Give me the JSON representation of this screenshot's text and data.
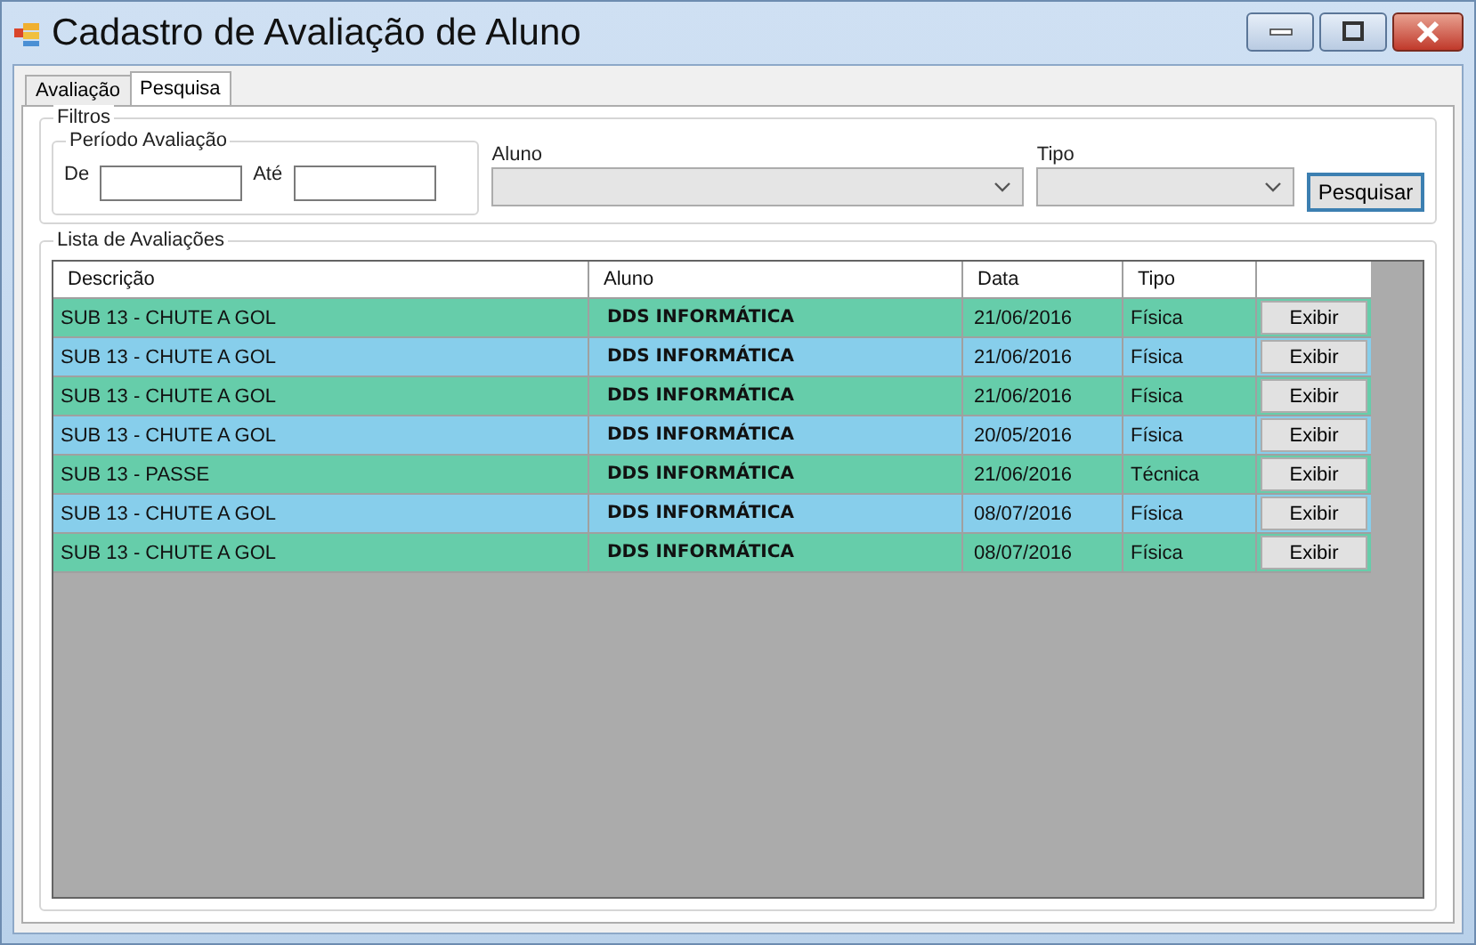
{
  "window": {
    "title": "Cadastro de Avaliação de Aluno"
  },
  "tabs": [
    {
      "label": "Avaliação",
      "selected": false
    },
    {
      "label": "Pesquisa",
      "selected": true
    }
  ],
  "filters": {
    "title": "Filtros",
    "period": {
      "title": "Período Avaliação",
      "from_label": "De",
      "to_label": "Até"
    },
    "student_label": "Aluno",
    "type_label": "Tipo",
    "search_button": "Pesquisar"
  },
  "list": {
    "title": "Lista de Avaliações",
    "columns": [
      "Descrição",
      "Aluno",
      "Data",
      "Tipo"
    ],
    "rows": [
      {
        "description": "SUB 13 - CHUTE A GOL",
        "student": "DDS INFORMÁTICA",
        "date": "21/06/2016",
        "type": "Física",
        "action": "Exibir",
        "color": "#66cdaa"
      },
      {
        "description": "SUB 13 - CHUTE A GOL",
        "student": "DDS INFORMÁTICA",
        "date": "21/06/2016",
        "type": "Física",
        "action": "Exibir",
        "color": "#87ceeb"
      },
      {
        "description": "SUB 13 - CHUTE A GOL",
        "student": "DDS INFORMÁTICA",
        "date": "21/06/2016",
        "type": "Física",
        "action": "Exibir",
        "color": "#66cdaa"
      },
      {
        "description": "SUB 13 - CHUTE A GOL",
        "student": "DDS INFORMÁTICA",
        "date": "20/05/2016",
        "type": "Física",
        "action": "Exibir",
        "color": "#87ceeb"
      },
      {
        "description": "SUB 13 - PASSE",
        "student": "DDS INFORMÁTICA",
        "date": "21/06/2016",
        "type": "Técnica",
        "action": "Exibir",
        "color": "#66cdaa"
      },
      {
        "description": "SUB 13 - CHUTE A GOL",
        "student": "DDS INFORMÁTICA",
        "date": "08/07/2016",
        "type": "Física",
        "action": "Exibir",
        "color": "#87ceeb"
      },
      {
        "description": "SUB 13 - CHUTE A GOL",
        "student": "DDS INFORMÁTICA",
        "date": "08/07/2016",
        "type": "Física",
        "action": "Exibir",
        "color": "#66cdaa"
      }
    ]
  }
}
